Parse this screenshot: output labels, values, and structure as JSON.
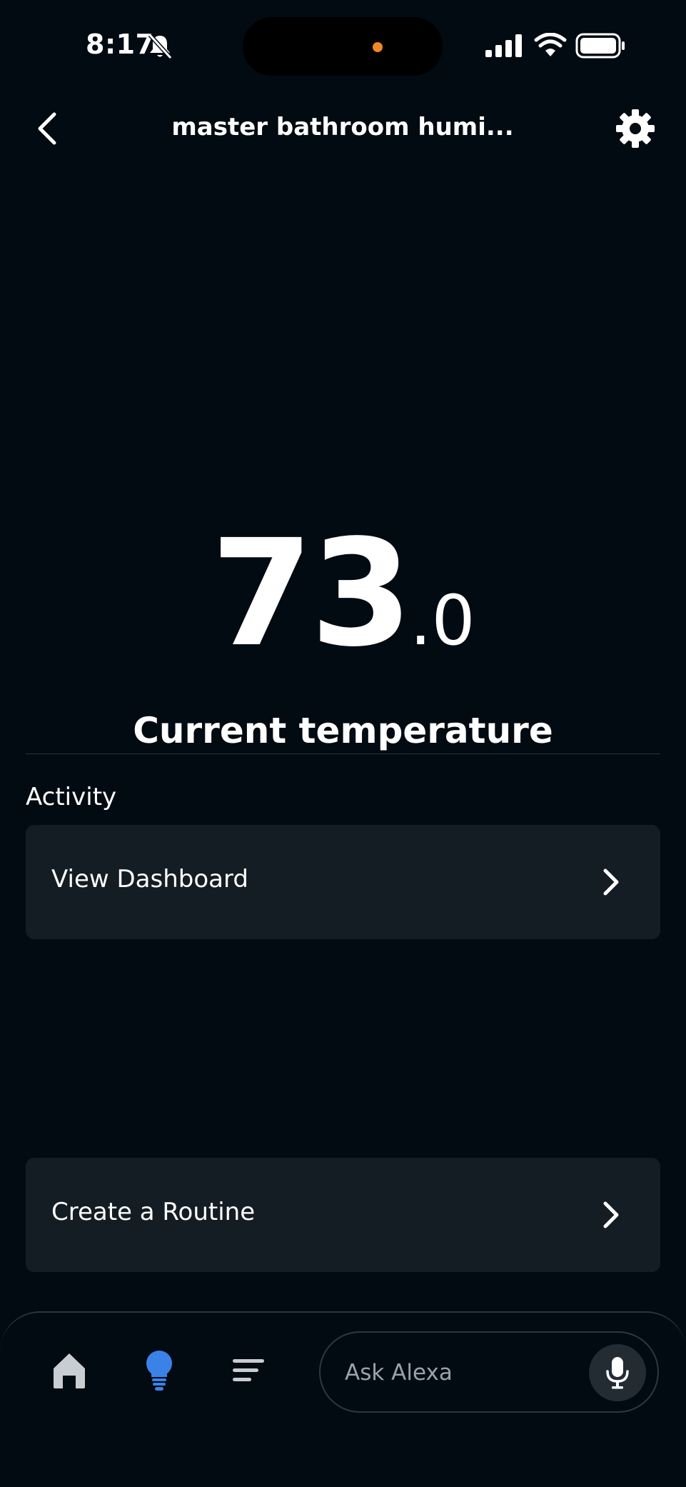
{
  "status_bar": {
    "time": "8:17",
    "icons": [
      "bell-slash-icon",
      "cellular-signal-icon",
      "wifi-icon",
      "battery-icon"
    ]
  },
  "header": {
    "title": "master bathroom humi...",
    "back_icon": "chevron-left-icon",
    "settings_icon": "gear-icon"
  },
  "reading": {
    "integer": "73",
    "decimal": ".0",
    "label": "Current temperature"
  },
  "activity": {
    "title": "Activity",
    "dashboard_label": "View Dashboard"
  },
  "routine": {
    "label": "Create a Routine"
  },
  "bottom_nav": {
    "items": [
      {
        "icon": "home-icon"
      },
      {
        "icon": "lightbulb-icon",
        "active": true
      },
      {
        "icon": "list-icon"
      }
    ],
    "ask_placeholder": "Ask Alexa",
    "mic_icon": "microphone-icon"
  },
  "colors": {
    "background": "#020a12",
    "card": "#141c24",
    "accent_blue": "#3b82e8",
    "island_dot": "#f08a24"
  }
}
